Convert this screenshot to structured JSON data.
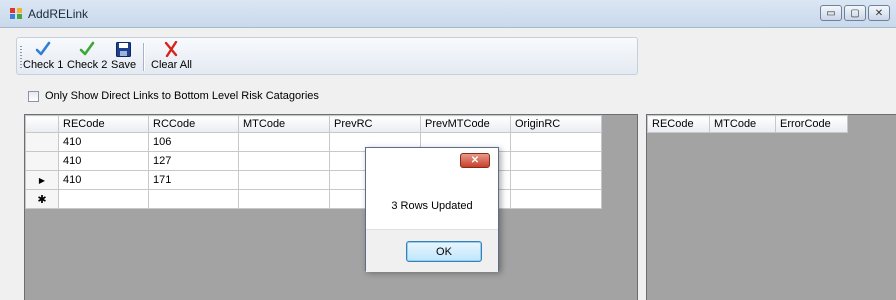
{
  "window": {
    "title": "AddRELink",
    "controls": {
      "minimize": "▭",
      "maximize": "▢",
      "close": "✕"
    }
  },
  "toolbar": {
    "buttons": [
      {
        "label": "Check 1",
        "icon": "checkmark-blue-icon"
      },
      {
        "label": "Check 2",
        "icon": "checkmark-green-icon"
      },
      {
        "label": "Save",
        "icon": "floppy-disk-icon"
      },
      {
        "label": "Clear All",
        "icon": "red-x-icon"
      }
    ]
  },
  "filter": {
    "label": "Only Show Direct Links to Bottom Level Risk Catagories",
    "checked": false
  },
  "left_grid": {
    "columns": [
      "RECode",
      "RCCode",
      "MTCode",
      "PrevRC",
      "PrevMTCode",
      "OriginRC"
    ],
    "rows": [
      [
        "410",
        "106",
        "",
        "",
        "",
        ""
      ],
      [
        "410",
        "127",
        "",
        "",
        "",
        ""
      ],
      [
        "410",
        "171",
        "",
        "",
        "",
        ""
      ]
    ],
    "current_row_marker": "▶",
    "new_row_marker": "✱"
  },
  "right_grid": {
    "columns": [
      "RECode",
      "MTCode",
      "ErrorCode"
    ]
  },
  "dialog": {
    "message": "3 Rows Updated",
    "ok_label": "OK",
    "close_glyph": "✕"
  },
  "colors": {
    "grid_background": "#a3a3a3",
    "check1": "#2f7fd4",
    "check2": "#3aa832",
    "clear": "#d8231c"
  }
}
